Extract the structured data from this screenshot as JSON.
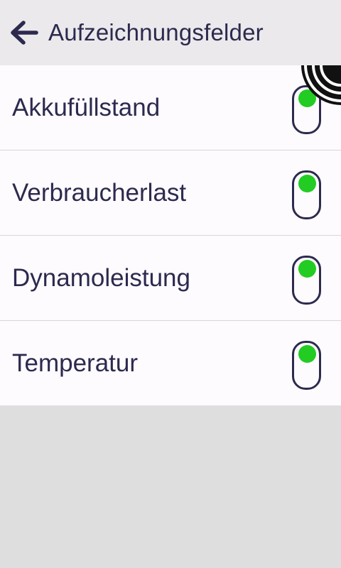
{
  "header": {
    "title": "Aufzeichnungsfelder",
    "back_icon": "arrow-left-icon"
  },
  "colors": {
    "text": "#2c2a4e",
    "toggle_on": "#22cc22",
    "header_bg": "#ebe9eb",
    "row_bg": "#fefbff",
    "page_bg": "#dedede"
  },
  "fields": [
    {
      "label": "Akkufüllstand",
      "enabled": true
    },
    {
      "label": "Verbraucherlast",
      "enabled": true
    },
    {
      "label": "Dynamoleistung",
      "enabled": true
    },
    {
      "label": "Temperatur",
      "enabled": true
    }
  ],
  "corner_badge_icon": "wireless-signal-icon"
}
